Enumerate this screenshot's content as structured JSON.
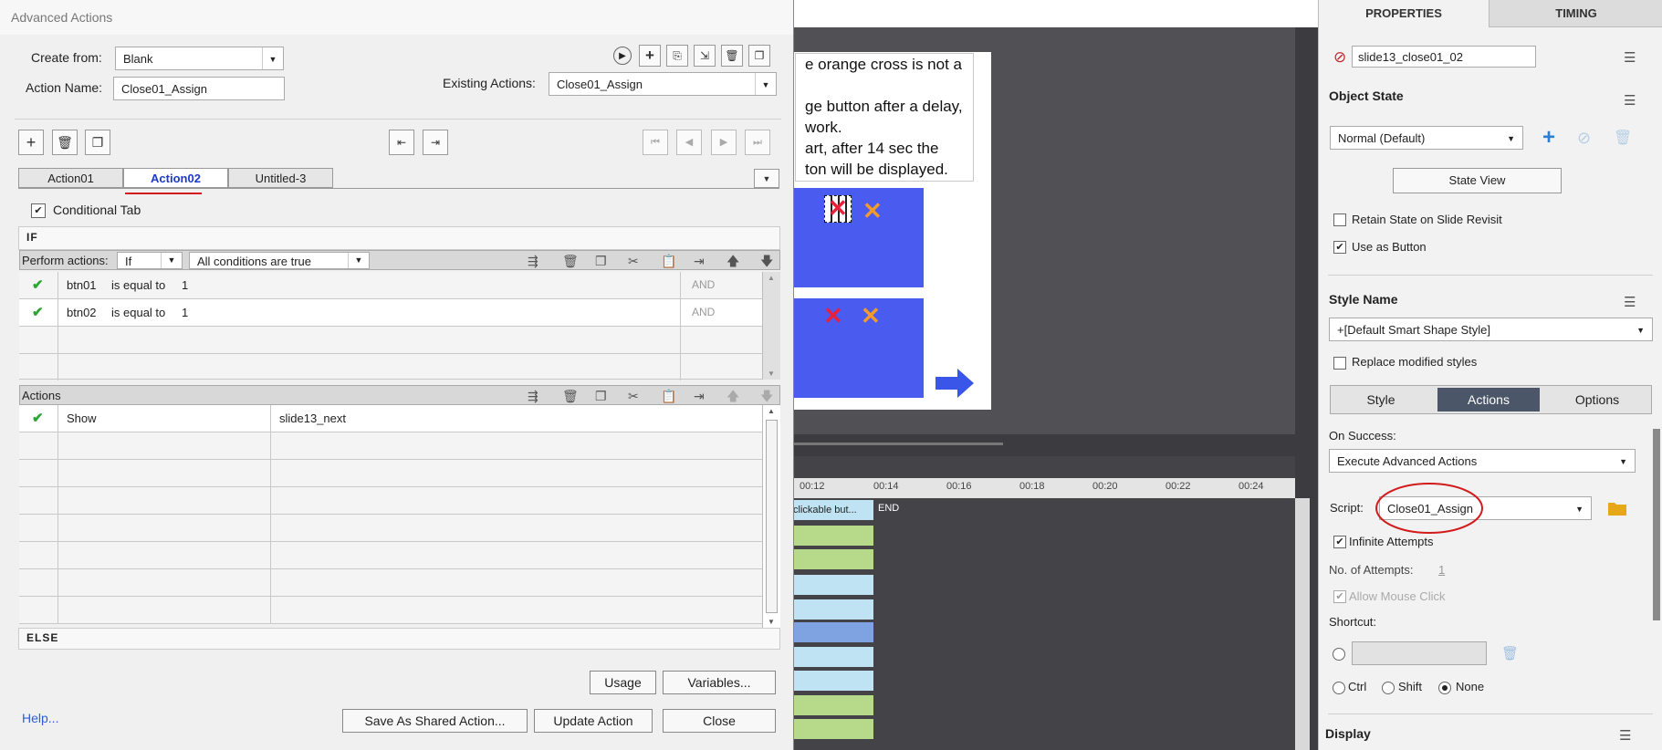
{
  "dialog": {
    "title": "Advanced Actions",
    "create_from_label": "Create from:",
    "create_from_value": "Blank",
    "action_name_label": "Action Name:",
    "action_name_value": "Close01_Assign",
    "existing_actions_label": "Existing Actions:",
    "existing_actions_value": "Close01_Assign",
    "tabs": [
      "Action01",
      "Action02",
      "Untitled-3"
    ],
    "active_tab": "Action02",
    "conditional_tab_label": "Conditional Tab",
    "conditional_tab_checked": true,
    "if_label": "IF",
    "perform_actions_label": "Perform actions:",
    "perform_actions_value": "If",
    "conditions_mode_value": "All conditions are true",
    "conditions": [
      {
        "variable": "btn01",
        "operator": "is equal to",
        "value": "1",
        "logic": "AND"
      },
      {
        "variable": "btn02",
        "operator": "is equal to",
        "value": "1",
        "logic": "AND"
      }
    ],
    "actions_label": "Actions",
    "actions": [
      {
        "action": "Show",
        "target": "slide13_next"
      }
    ],
    "else_label": "ELSE",
    "usage_button": "Usage",
    "variables_button": "Variables...",
    "help_link": "Help...",
    "save_shared_button": "Save As Shared Action...",
    "update_button": "Update Action",
    "close_button": "Close"
  },
  "slide": {
    "caption_lines": [
      "e orange cross is not a",
      "",
      "ge button after a delay,",
      " work.",
      "art, after 14 sec the",
      "ton will be displayed."
    ],
    "cross_glyph": "✕"
  },
  "timeline": {
    "ticks": [
      "00:12",
      "00:14",
      "00:16",
      "00:18",
      "00:20",
      "00:22",
      "00:24"
    ],
    "clip_label": "clickable but...",
    "end_label": "END"
  },
  "properties": {
    "tab_properties": "PROPERTIES",
    "tab_timing": "TIMING",
    "object_name": "slide13_close01_02",
    "object_state_title": "Object State",
    "state_value": "Normal (Default)",
    "state_view_button": "State View",
    "retain_state_label": "Retain State on Slide Revisit",
    "retain_state_checked": false,
    "use_as_button_label": "Use as Button",
    "use_as_button_checked": true,
    "style_name_title": "Style Name",
    "style_value": "+[Default Smart Shape Style]",
    "replace_styles_label": "Replace modified styles",
    "subtabs": [
      "Style",
      "Actions",
      "Options"
    ],
    "active_subtab": "Actions",
    "on_success_label": "On Success:",
    "on_success_value": "Execute Advanced Actions",
    "script_label": "Script:",
    "script_value": "Close01_Assign",
    "infinite_attempts_label": "Infinite Attempts",
    "infinite_attempts_checked": true,
    "attempts_label": "No. of Attempts:",
    "attempts_value": "1",
    "allow_mouse_label": "Allow Mouse Click",
    "shortcut_label": "Shortcut:",
    "modifiers": [
      "Ctrl",
      "Shift",
      "None"
    ],
    "selected_modifier": "None",
    "display_title": "Display"
  },
  "colors": {
    "accent_blue": "#2f5fd0",
    "annotation_red": "#d21b1b",
    "check_green": "#2aa534",
    "slide_blue": "#4a5cf0",
    "cross_orange": "#f39a2a",
    "cross_red": "#e8203a",
    "folder_yellow": "#e6a817"
  }
}
